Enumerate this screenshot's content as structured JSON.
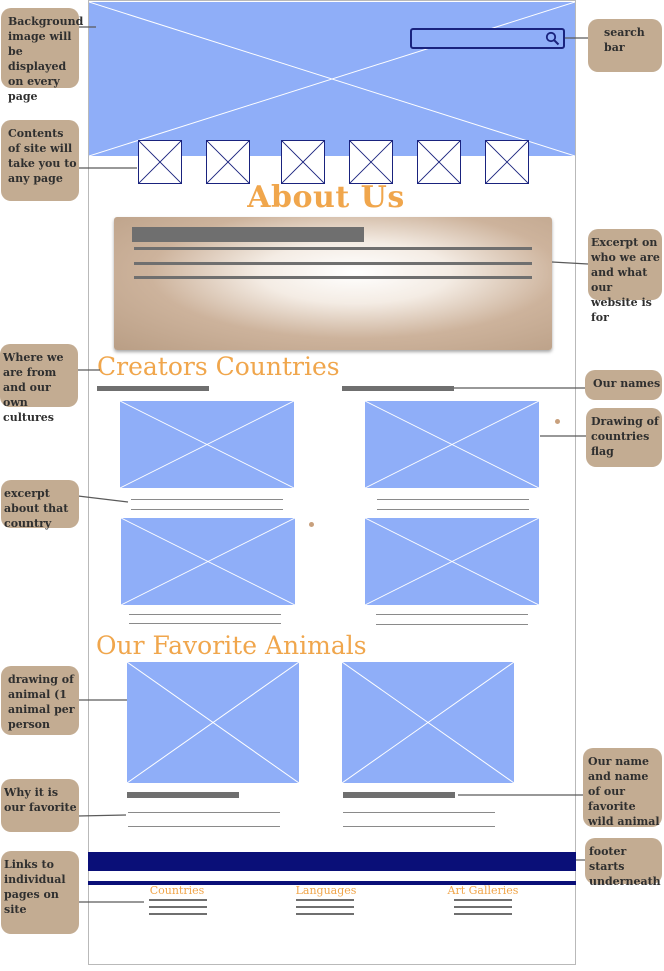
{
  "page": {
    "about_title": "About Us",
    "creators_title": "Creators Countries",
    "animals_title": "Our Favorite Animals"
  },
  "footer": {
    "links": [
      "Countries",
      "Languages",
      "Art Galleries"
    ]
  },
  "annotations": {
    "background": "Background image will be displayed on every page",
    "contents": "Contents of site will take you to any page",
    "from": "Where we are from and our own cultures",
    "excerpt_country": "excerpt about that country",
    "drawing_animal": "drawing of animal (1 animal per person",
    "why": "Why it is our favorite",
    "links": "Links to individual pages on site",
    "search": "search bar",
    "excerpt_about": "Excerpt on who we are and what our website is for",
    "names": "Our names",
    "flag": "Drawing of countries flag",
    "our_name_animal": "Our name and name of our favorite wild animal",
    "footer": "footer starts underneath"
  },
  "colors": {
    "placeholder": "#8faef8",
    "accent": "#f0a64c",
    "navy": "#0a0f78",
    "note": "#c3ac92"
  },
  "icons": {
    "search": "magnifier-icon",
    "placeholder": "image-placeholder-x"
  }
}
